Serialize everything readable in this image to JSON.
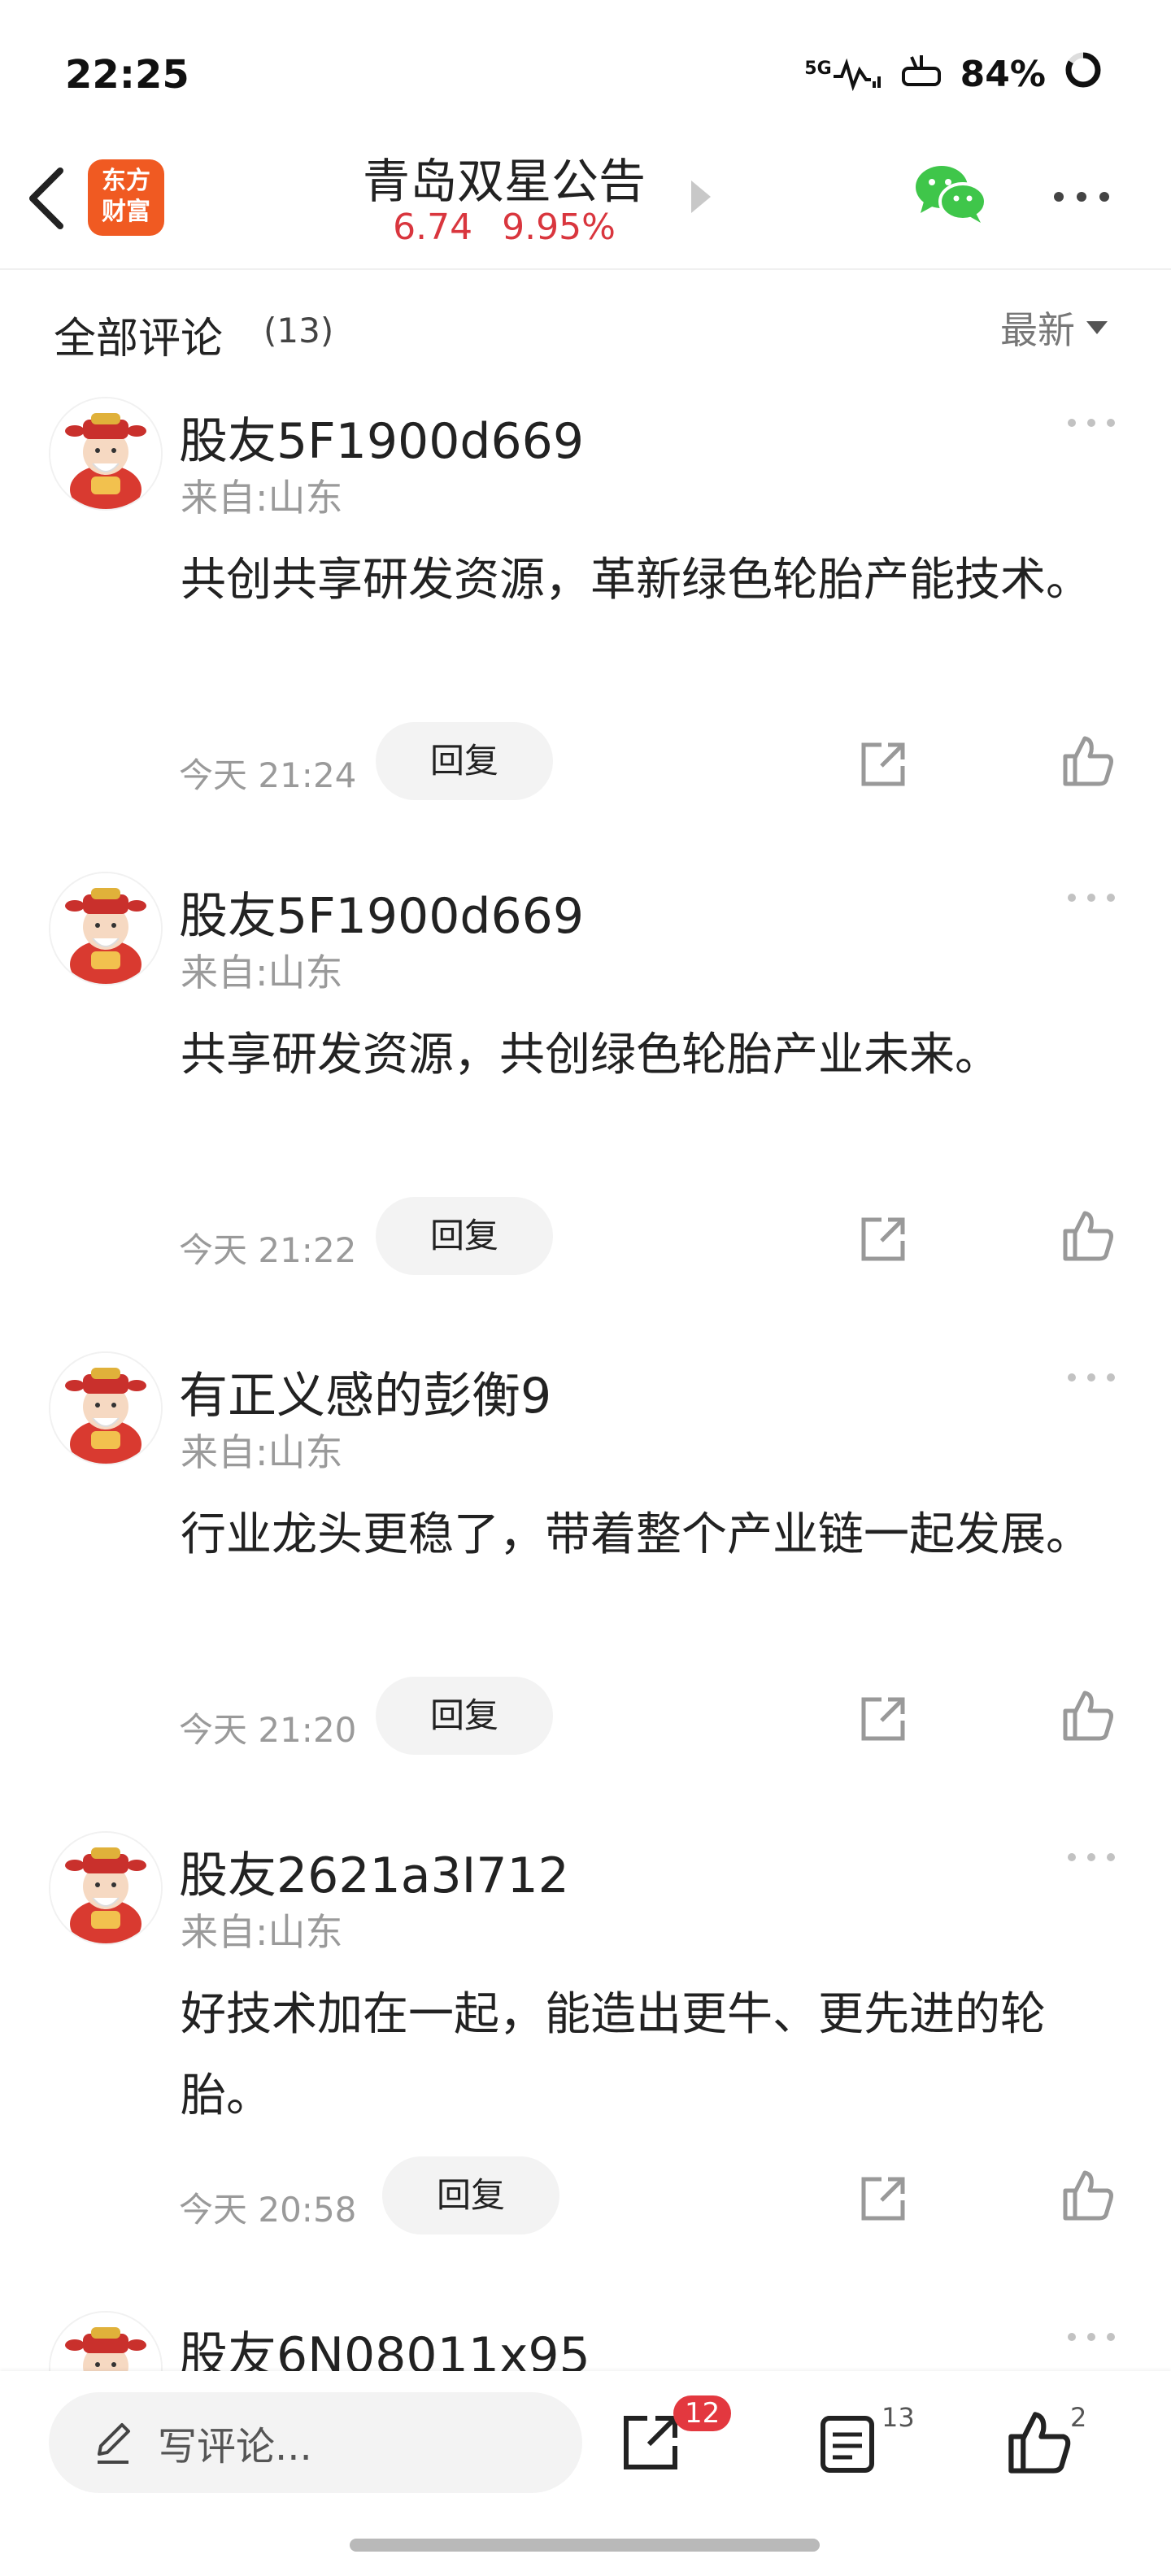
{
  "status_bar": {
    "time": "22:25",
    "network": "5G",
    "battery": "84%"
  },
  "header": {
    "logo_line1": "东方",
    "logo_line2": "财富",
    "title": "青岛双星公告",
    "price": "6.74",
    "change": "9.95%"
  },
  "section": {
    "title": "全部评论",
    "count": "(13)",
    "sort_label": "最新"
  },
  "comments": [
    {
      "user": "股友5F1900d669",
      "location": "来自:山东",
      "text": "共创共享研发资源，革新绿色轮胎产能技术。",
      "time": "今天 21:24",
      "reply_label": "回复"
    },
    {
      "user": "股友5F1900d669",
      "location": "来自:山东",
      "text": "共享研发资源，共创绿色轮胎产业未来。",
      "time": "今天 21:22",
      "reply_label": "回复"
    },
    {
      "user": "有正义感的彭衡9",
      "location": "来自:山东",
      "text": "行业龙头更稳了，带着整个产业链一起发展。",
      "time": "今天 21:20",
      "reply_label": "回复"
    },
    {
      "user": "股友2621a3I712",
      "location": "来自:山东",
      "text": "好技术加在一起，能造出更牛、更先进的轮胎。",
      "time": "今天 20:58",
      "reply_label": "回复"
    },
    {
      "user": "股友6N08011x95"
    }
  ],
  "bottom_bar": {
    "placeholder": "写评论...",
    "share_badge": "12",
    "comment_count": "13",
    "like_count": "2"
  },
  "colors": {
    "accent_red": "#d9363e",
    "brand_orange": "#f05a22",
    "wechat_green": "#3fc64a"
  }
}
